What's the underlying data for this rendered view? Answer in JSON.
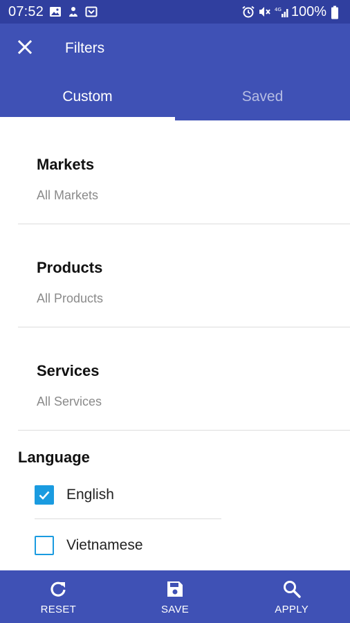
{
  "status_bar": {
    "time": "07:52",
    "battery": "100%",
    "left_icons": [
      "image-icon",
      "notification-icon",
      "cast-icon"
    ],
    "right_icons": [
      "alarm-icon",
      "mute-icon",
      "signal-icon",
      "battery-icon"
    ]
  },
  "app_bar": {
    "title": "Filters",
    "close_icon": "close-icon"
  },
  "tabs": [
    {
      "label": "Custom",
      "active": true
    },
    {
      "label": "Saved",
      "active": false
    }
  ],
  "sections": [
    {
      "title": "Markets",
      "value": "All Markets"
    },
    {
      "title": "Products",
      "value": "All Products"
    },
    {
      "title": "Services",
      "value": "All Services"
    }
  ],
  "language": {
    "title": "Language",
    "options": [
      {
        "label": "English",
        "checked": true
      },
      {
        "label": "Vietnamese",
        "checked": false
      }
    ]
  },
  "bottom_bar": {
    "reset": "RESET",
    "save": "SAVE",
    "apply": "APPLY"
  },
  "colors": {
    "status_bar": "#303f9f",
    "primary": "#3f51b5",
    "checkbox": "#1a9be0"
  }
}
